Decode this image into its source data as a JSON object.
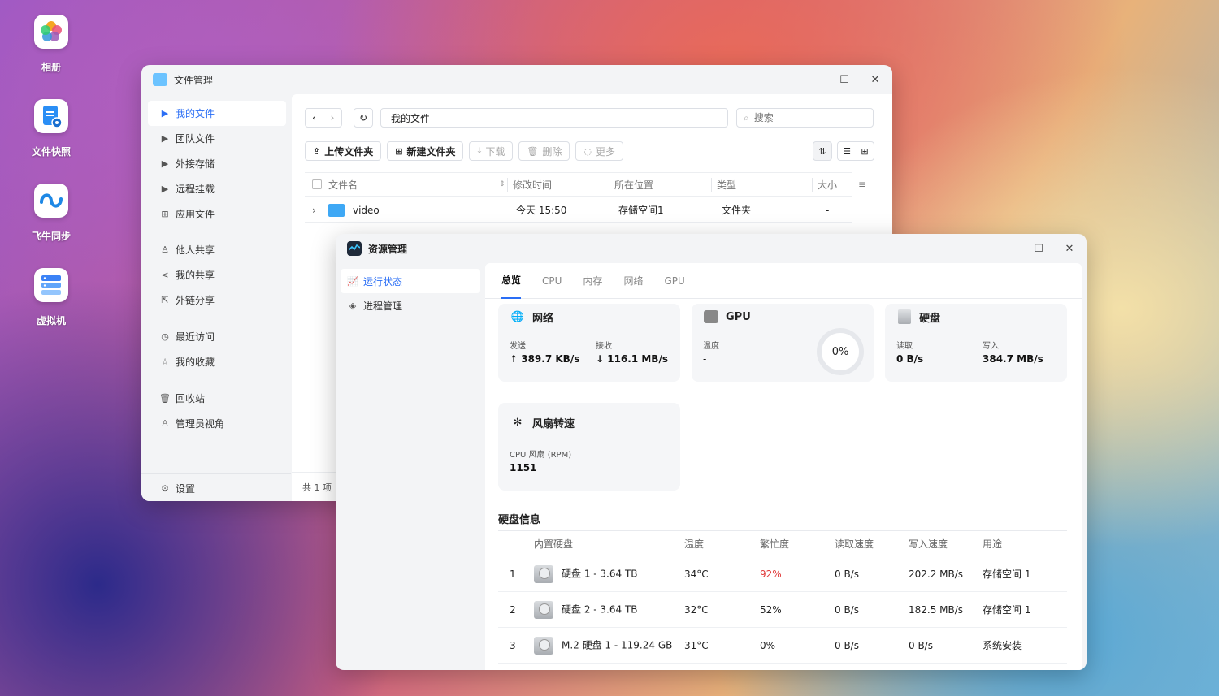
{
  "desktop": {
    "icons": [
      {
        "label": "相册",
        "icon": "photos-icon"
      },
      {
        "label": "文件快照",
        "icon": "file-snapshot-icon"
      },
      {
        "label": "飞牛同步",
        "icon": "sync-icon"
      },
      {
        "label": "虚拟机",
        "icon": "virtual-machine-icon"
      }
    ]
  },
  "file_manager": {
    "title": "文件管理",
    "sidebar": {
      "items": [
        {
          "label": "我的文件",
          "active": true
        },
        {
          "label": "团队文件"
        },
        {
          "label": "外接存储"
        },
        {
          "label": "远程挂载"
        },
        {
          "label": "应用文件"
        },
        {
          "label": "他人共享"
        },
        {
          "label": "我的共享"
        },
        {
          "label": "外链分享"
        },
        {
          "label": "最近访问"
        },
        {
          "label": "我的收藏"
        },
        {
          "label": "回收站"
        },
        {
          "label": "管理员视角"
        }
      ],
      "settings": "设置"
    },
    "path": "我的文件",
    "search_placeholder": "搜索",
    "toolbar": {
      "upload": "上传文件夹",
      "new_folder": "新建文件夹",
      "download": "下载",
      "delete": "删除",
      "more": "更多"
    },
    "columns": [
      "文件名",
      "修改时间",
      "所在位置",
      "类型",
      "大小"
    ],
    "rows": [
      {
        "name": "video",
        "modified": "今天 15:50",
        "location": "存储空间1",
        "type": "文件夹",
        "size": "-"
      }
    ],
    "count": "共 1 项"
  },
  "resource_manager": {
    "title": "资源管理",
    "sidebar": {
      "items": [
        {
          "label": "运行状态",
          "active": true
        },
        {
          "label": "进程管理"
        }
      ]
    },
    "tabs": [
      "总览",
      "CPU",
      "内存",
      "网络",
      "GPU"
    ],
    "network": {
      "title": "网络",
      "send_label": "发送",
      "send": "389.7 KB/s",
      "recv_label": "接收",
      "recv": "116.1 MB/s"
    },
    "gpu": {
      "title": "GPU",
      "temp_label": "温度",
      "temp": "-",
      "usage": "0%"
    },
    "disk": {
      "title": "硬盘",
      "read_label": "读取",
      "read": "0 B/s",
      "write_label": "写入",
      "write": "384.7 MB/s"
    },
    "fan": {
      "title": "风扇转速",
      "label": "CPU 风扇 (RPM)",
      "value": "1151"
    },
    "disk_info": {
      "title": "硬盘信息",
      "columns": [
        "内置硬盘",
        "温度",
        "繁忙度",
        "读取速度",
        "写入速度",
        "用途"
      ],
      "rows": [
        {
          "index": "1",
          "name": "硬盘 1 - 3.64 TB",
          "temp": "34°C",
          "busy": "92%",
          "read": "0 B/s",
          "write": "202.2 MB/s",
          "use": "存储空间 1"
        },
        {
          "index": "2",
          "name": "硬盘 2 - 3.64 TB",
          "temp": "32°C",
          "busy": "52%",
          "read": "0 B/s",
          "write": "182.5 MB/s",
          "use": "存储空间 1"
        },
        {
          "index": "3",
          "name": "M.2 硬盘 1 - 119.24 GB",
          "temp": "31°C",
          "busy": "0%",
          "read": "0 B/s",
          "write": "0 B/s",
          "use": "系统安装"
        }
      ]
    },
    "colors": {
      "accent": "#2a6ef5",
      "busy_high": "#e03a3a"
    }
  }
}
